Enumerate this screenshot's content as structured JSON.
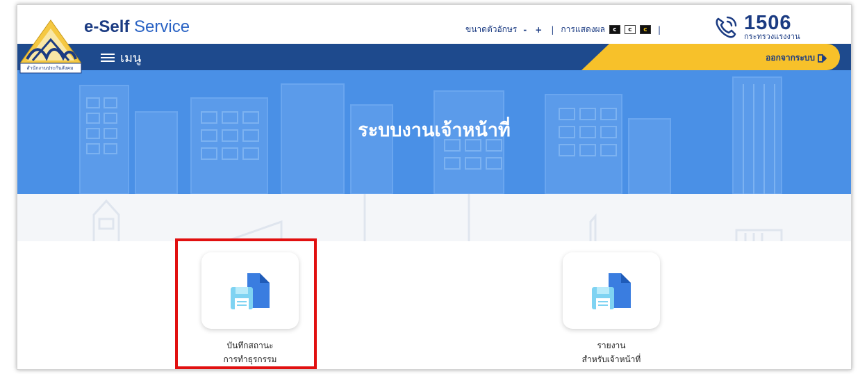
{
  "header": {
    "brand_strong": "e-Self",
    "brand_light": "Service",
    "font_size_label": "ขนาดตัวอักษร",
    "font_minus": "-",
    "font_plus": "+",
    "display_label": "การแสดงผล",
    "contrast_options": [
      "c",
      "c",
      "c"
    ],
    "hotline_number": "1506",
    "hotline_org": "กระทรวงแรงงาน",
    "logo_caption": "สำนักงานประกันสังคม"
  },
  "nav": {
    "menu_label": "เมนู",
    "logout_label": "ออกจากระบบ"
  },
  "hero": {
    "title": "ระบบงานเจ้าหน้าที่"
  },
  "cards": [
    {
      "line1": "บันทึกสถานะ",
      "line2": "การทำธุรกรรม",
      "icon": "document-save-icon"
    },
    {
      "line1": "รายงาน",
      "line2": "สำหรับเจ้าหน้าที่",
      "icon": "document-save-icon"
    }
  ],
  "colors": {
    "navy": "#1e4a8d",
    "accent_yellow": "#f7c12a",
    "hero_blue": "#4a90e6",
    "highlight_red": "#e11010"
  }
}
